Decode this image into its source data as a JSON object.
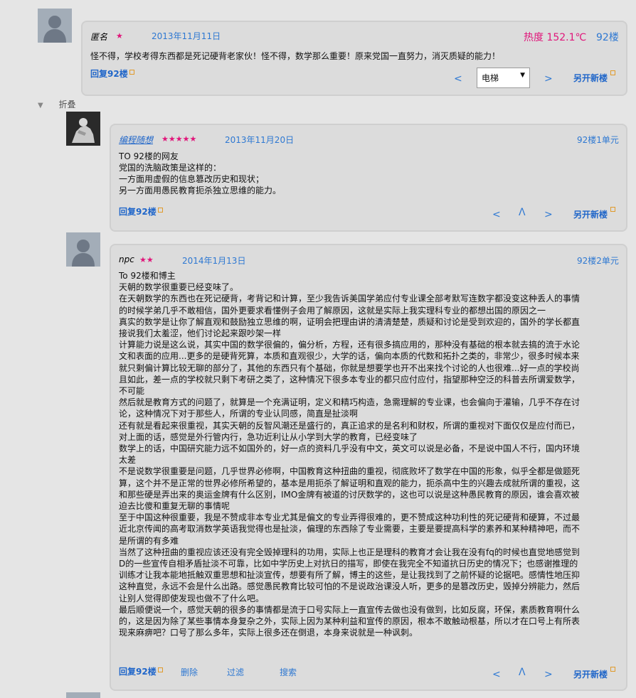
{
  "post92": {
    "author": "匿名",
    "stars": "★",
    "date": "2013年11月11日",
    "heat": "热度 152.1℃",
    "floor": "92楼",
    "content": "怪不得，学校考得东西都是死记硬背老家伙！怪不得，数学那么重要！原来党国一直努力，消灭质疑的能力！",
    "reply_label": "回复92楼",
    "prev": "<",
    "next": ">",
    "select_value": "电梯",
    "select_arrow": "▼",
    "new_floor": "另开新楼"
  },
  "fold": {
    "label": "折叠",
    "icon": "▼"
  },
  "reply1": {
    "author": "编程随想",
    "stars": "★★★★★",
    "date": "2013年11月20日",
    "floor": "92楼1单元",
    "lines": [
      "TO 92楼的网友",
      "党国的洗脑政策是这样的：",
      "一方面用虚假的信息篡改历史和现状；",
      "另一方面用愚民教育扼杀独立思维的能力。"
    ],
    "reply_label": "回复92楼",
    "prev": "<",
    "up": "Λ",
    "next": ">",
    "new_floor": "另开新楼"
  },
  "reply2": {
    "author": "npc",
    "stars": "★★",
    "date": "2014年1月13日",
    "floor": "92楼2单元",
    "lines": [
      "To 92楼和博主",
      "天朝的数学很重要已经变味了。",
      "在天朝数学的东西也在死记硬背，考背记和计算，至少我告诉美国学弟应付专业课全部考默写连数字都没变这种丢人的事情",
      "的时候学弟几乎不敢相信，国外更要求看懂例子会用了解原因，这就是实际上我实理科专业的都想出国的原因之一",
      "真实的数学是让你了解直观和鼓励独立思维的啊，证明会把理由讲的清清楚楚，质疑和讨论是受到欢迎的，国外的学长都直",
      "接说我们太羞涩，他们讨论起来跟吵架一样",
      "计算能力说是这么说，其实中国的数学很偏的，偏分析，方程，还有很多搞应用的，那种没有基础的根本就去搞的流于水论",
      "文和表面的应用...更多的是硬背死算，本质和直观很少，大学的话，偏向本质的代数和拓扑之类的，非常少，很多时候本来",
      "就只剩偏计算比较无聊的部分了，其他的东西只有个基础，你就是想要学也开不出来找个讨论的人也很难...好一点的学校尚",
      "且如此，差一点的学校就只剩下考研之类了，这种情况下很多本专业的都只应付应付，指望那种空泛的科普去所谓爱数学，",
      "不可能",
      "然后就是教育方式的问题了，就算是一个充满证明，定义和精巧构造，急需理解的专业课，也会偏向于灌输，几乎不存在讨",
      "论，这种情况下对于那些人，所谓的专业认同感，简直是扯淡啊",
      "还有就是看起来很重视，其实天朝的反智风潮还是盛行的，真正追求的是名利和财权，所谓的重视对下面仅仅是应付而已，",
      "对上面的话，感觉是外行管内行，急功近利让从小学到大学的教育，已经变味了",
      "数学上的话，中国研究能力远不如国外的，好一点的资料几乎没有中文，英文可以说是必备，不是说中国人不行，国内环境",
      "太差",
      "不是说数学很重要是问题，几乎世界必修啊，中国教育这种扭曲的重视，彻底败坏了数学在中国的形象，似乎全都是做题死",
      "算，这个并不是正常的世界必修所希望的，基本是用扼杀了解证明和直观的能力，扼杀高中生的兴趣去成就所谓的重视，这",
      "和那些硬是弄出来的奥运金牌有什么区别，IMO金牌有被道的讨厌数学的，这也可以说是这种愚民教育的原因，谁会喜欢被",
      "迫去比傻和重复无聊的事情呢",
      "至于中国这种很重要，我是不赞成非本专业尤其是偏文的专业弄得很难的，更不赞成这种功利性的死记硬背和硬算，不过最",
      "近北京传闻的高考取消数学英语我觉得也是扯淡，偏理的东西除了专业需要，主要是要提高科学的素养和某种精神吧，而不",
      "是所谓的有多难",
      "当然了这种扭曲的重视应该还没有完全毁掉理科的功用，实际上也正是理科的教育才会让我在没有fq的时候也直觉地感觉到",
      "D的一些宣传自相矛盾扯淡不可靠，比如中学历史上对抗日的描写，即使在我完全不知道抗日历史的情况下；也感谢推理的",
      "训练才让我本能地抵触双重思想和扯淡宣传，想要有所了解，博主的这些，是让我找到了之前怀疑的论据吧。感情性地压抑",
      "这种直觉，永远不会是什么出路。感觉愚民教育比较可怕的不是说政治课没人听，更多的是篡改历史，毁掉分辨能力，然后",
      "让别人觉得即使发现也做不了什么吧。",
      "最后顺便说一个，感觉天朝的很多的事情都是流于口号实际上一直宣传去做也没有做到，比如反腐，环保，素质教育啊什么",
      "的，这是因为除了某些事情本身复杂之外，实际上因为某种利益和宣传的原因，根本不敢触动根基，所以才在口号上有所表",
      "现来麻痹吧？口号了那么多年，实际上很多还在倒退，本身来说就是一种讽刺。"
    ],
    "reply_label": "回复92楼",
    "delete_label": "删除",
    "filter_label": "过滤",
    "search_label": "搜索",
    "prev": "<",
    "up": "Λ",
    "next": ">",
    "new_floor": "另开新楼"
  },
  "icons": {
    "default_avatar": "person-silhouette",
    "thinker_avatar": "thinker-statue",
    "external_link": "external-link-icon"
  },
  "colors": {
    "link": "#2066c9",
    "date": "#2e78d2",
    "stars": "#e0167a",
    "heat": "#e0167a",
    "panel": "#dcdcdc",
    "page": "#e5e5e5"
  }
}
